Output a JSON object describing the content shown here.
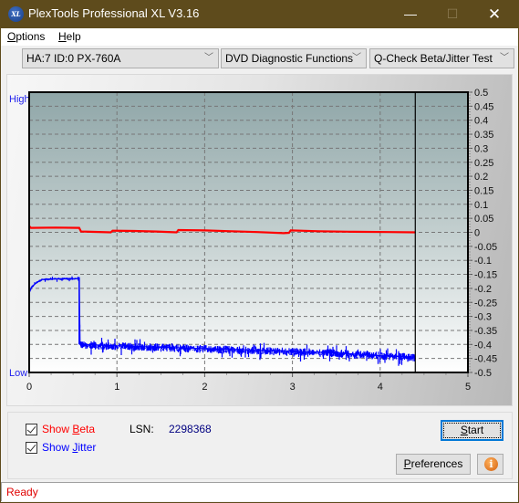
{
  "window": {
    "title": "PlexTools Professional XL V3.16",
    "app_icon_text": "XL",
    "controls": {
      "minimize": "—",
      "maximize": "☐",
      "close": "✕"
    }
  },
  "menu": {
    "items": [
      {
        "label": "Options",
        "accel": "O"
      },
      {
        "label": "Help",
        "accel": "H"
      }
    ]
  },
  "toolbar": {
    "drive_select": "HA:7 ID:0  PX-760A",
    "function_select": "DVD Diagnostic Functions",
    "test_select": "Q-Check Beta/Jitter Test",
    "chevron": "﹀"
  },
  "chart_data": {
    "type": "line",
    "title": "",
    "xlabel": "",
    "ylabel": "",
    "y_left_labels": {
      "high": "High",
      "low": "Low"
    },
    "xlim": [
      0,
      5
    ],
    "ylim": [
      -0.5,
      0.5
    ],
    "x_ticks": [
      "0",
      "1",
      "2",
      "3",
      "4",
      "5"
    ],
    "y_ticks": [
      "0.5",
      "0.45",
      "0.4",
      "0.35",
      "0.3",
      "0.25",
      "0.2",
      "0.15",
      "0.1",
      "0.05",
      "0",
      "-0.05",
      "-0.1",
      "-0.15",
      "-0.2",
      "-0.25",
      "-0.3",
      "-0.35",
      "-0.4",
      "-0.45",
      "-0.5"
    ],
    "grid": true,
    "end_marker_x": 4.4,
    "series": [
      {
        "name": "Beta",
        "color": "#ff0000",
        "points": [
          [
            0.0,
            0.022
          ],
          [
            0.02,
            0.016
          ],
          [
            0.3,
            0.017
          ],
          [
            0.57,
            0.016
          ],
          [
            0.59,
            0.003
          ],
          [
            0.7,
            0.002
          ],
          [
            0.93,
            0.0
          ],
          [
            0.95,
            0.006
          ],
          [
            1.2,
            0.005
          ],
          [
            1.45,
            0.003
          ],
          [
            1.68,
            0.0
          ],
          [
            1.7,
            0.008
          ],
          [
            2.0,
            0.007
          ],
          [
            2.3,
            0.004
          ],
          [
            2.6,
            0.001
          ],
          [
            2.9,
            -0.003
          ],
          [
            2.96,
            -0.002
          ],
          [
            2.98,
            0.007
          ],
          [
            3.3,
            0.004
          ],
          [
            3.7,
            0.002
          ],
          [
            4.1,
            0.001
          ],
          [
            4.4,
            0.0
          ]
        ]
      },
      {
        "name": "Jitter",
        "color": "#0000ff",
        "points": [
          [
            0.0,
            -0.215
          ],
          [
            0.03,
            -0.195
          ],
          [
            0.08,
            -0.18
          ],
          [
            0.15,
            -0.168
          ],
          [
            0.3,
            -0.166
          ],
          [
            0.57,
            -0.165
          ],
          [
            0.58,
            -0.4
          ],
          [
            1.0,
            -0.405
          ],
          [
            1.5,
            -0.41
          ],
          [
            2.0,
            -0.415
          ],
          [
            2.5,
            -0.42
          ],
          [
            3.0,
            -0.425
          ],
          [
            3.5,
            -0.43
          ],
          [
            4.0,
            -0.44
          ],
          [
            4.4,
            -0.445
          ]
        ],
        "noise_band": 0.02
      }
    ]
  },
  "controls": {
    "show_beta": {
      "label": "Show Beta",
      "accel": "B",
      "checked": true,
      "color": "#ff0000"
    },
    "show_jitter": {
      "label": "Show Jitter",
      "accel": "J",
      "checked": true,
      "color": "#0000ff"
    },
    "lsn_label": "LSN:",
    "lsn_value": "2298368",
    "start_button": "Start",
    "preferences_button": "Preferences",
    "info_icon": "i"
  },
  "status": {
    "text": "Ready"
  }
}
